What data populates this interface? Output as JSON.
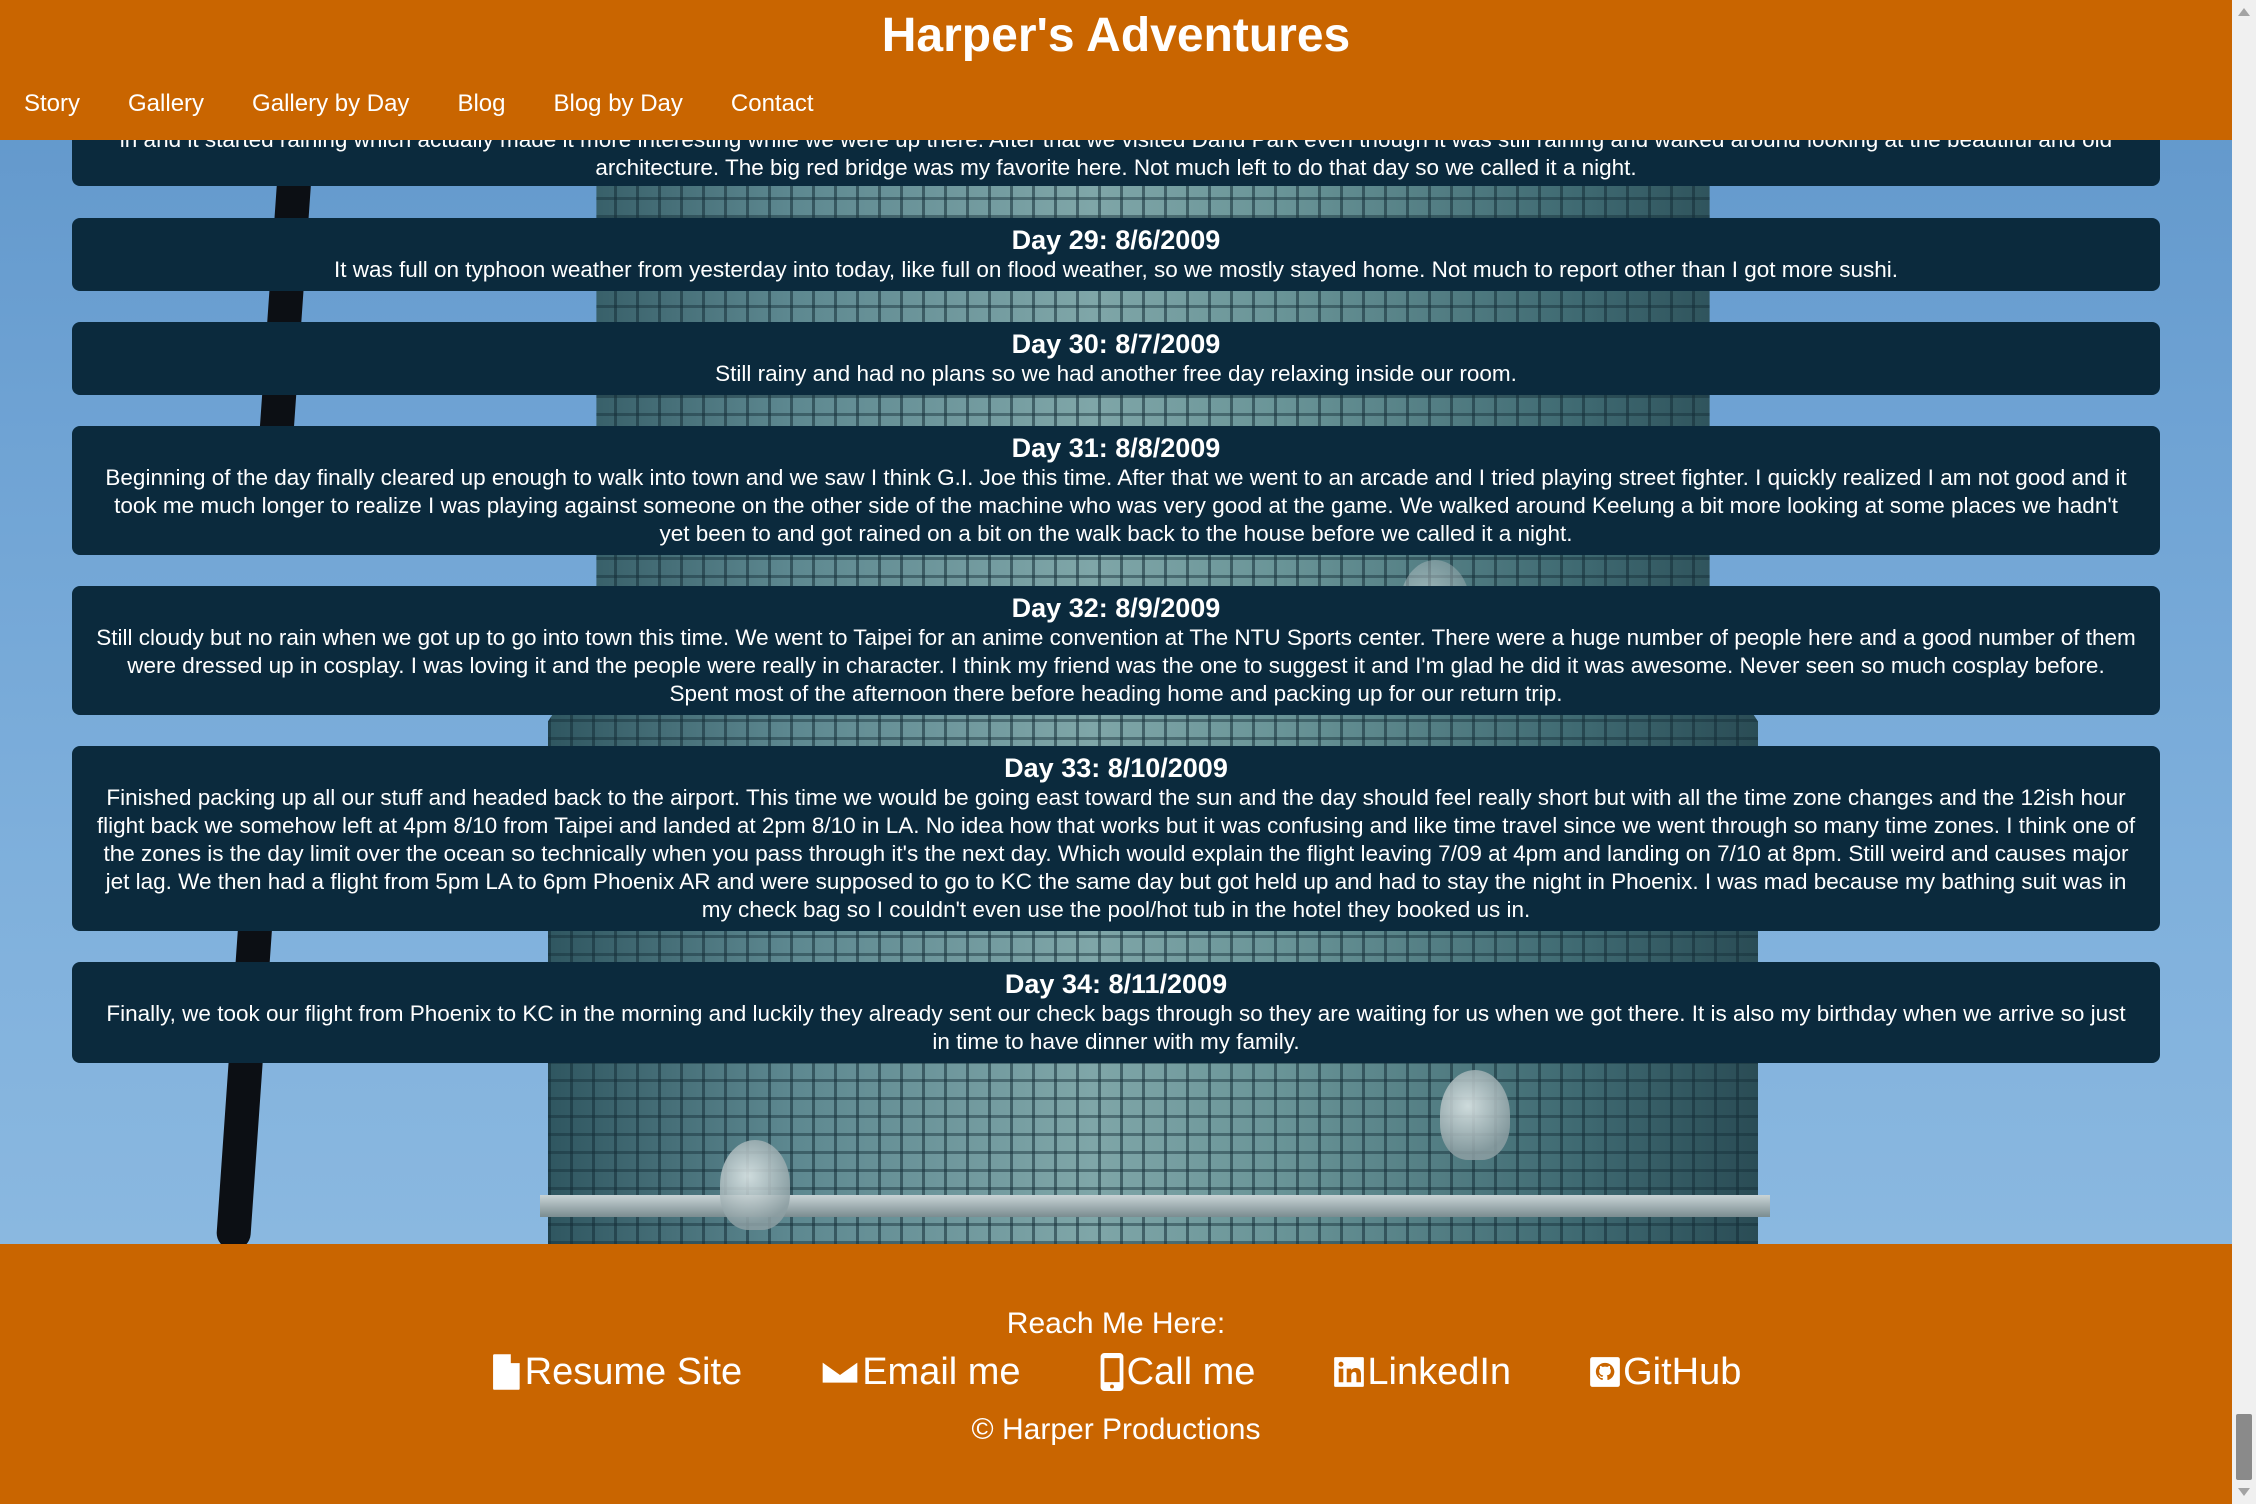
{
  "header": {
    "title": "Harper's Adventures",
    "nav": [
      "Story",
      "Gallery",
      "Gallery by Day",
      "Blog",
      "Blog by Day",
      "Contact"
    ]
  },
  "days": [
    {
      "title": "",
      "text": "in and it started raining which actually made it more interesting while we were up there. After that we visited Dand Park even though it was still raining and walked around looking at the beautiful and old architecture. The big red bridge was my favorite here. Not much left to do that day so we called it a night."
    },
    {
      "title": "Day 29: 8/6/2009",
      "text": "It was full on typhoon weather from yesterday into today, like full on flood weather, so we mostly stayed home. Not much to report other than I got more sushi."
    },
    {
      "title": "Day 30: 8/7/2009",
      "text": "Still rainy and had no plans so we had another free day relaxing inside our room."
    },
    {
      "title": "Day 31: 8/8/2009",
      "text": "Beginning of the day finally cleared up enough to walk into town and we saw I think G.I. Joe this time. After that we went to an arcade and I tried playing street fighter. I quickly realized I am not good and it took me much longer to realize I was playing against someone on the other side of the machine who was very good at the game. We walked around Keelung a bit more looking at some places we hadn't yet been to and got rained on a bit on the walk back to the house before we called it a night."
    },
    {
      "title": "Day 32: 8/9/2009",
      "text": "Still cloudy but no rain when we got up to go into town this time. We went to Taipei for an anime convention at The NTU Sports center. There were a huge number of people here and a good number of them were dressed up in cosplay. I was loving it and the people were really in character. I think my friend was the one to suggest it and I'm glad he did it was awesome. Never seen so much cosplay before. Spent most of the afternoon there before heading home and packing up for our return trip."
    },
    {
      "title": "Day 33: 8/10/2009",
      "text": "Finished packing up all our stuff and headed back to the airport. This time we would be going east toward the sun and the day should feel really short but with all the time zone changes and the 12ish hour flight back we somehow left at 4pm 8/10 from Taipei and landed at 2pm 8/10 in LA. No idea how that works but it was confusing and like time travel since we went through so many time zones. I think one of the zones is the day limit over the ocean so technically when you pass through it's the next day. Which would explain the flight leaving 7/09 at 4pm and landing on 7/10 at 8pm. Still weird and causes major jet lag. We then had a flight from 5pm LA to 6pm Phoenix AR and were supposed to go to KC the same day but got held up and had to stay the night in Phoenix. I was mad because my bathing suit was in my check bag so I couldn't even use the pool/hot tub in the hotel they booked us in."
    },
    {
      "title": "Day 34: 8/11/2009",
      "text": "Finally, we took our flight from Phoenix to KC in the morning and luckily they already sent our check bags through so they are waiting for us when we got there. It is also my birthday when we arrive so just in time to have dinner with my family."
    }
  ],
  "footer": {
    "reach": "Reach Me Here:",
    "links": [
      {
        "label": "Resume Site",
        "icon": "file-icon"
      },
      {
        "label": "Email me",
        "icon": "envelope-icon"
      },
      {
        "label": "Call me",
        "icon": "mobile-phone-icon"
      },
      {
        "label": "LinkedIn",
        "icon": "linkedin-icon"
      },
      {
        "label": "GitHub",
        "icon": "github-icon"
      }
    ],
    "copyright": "© Harper Productions"
  },
  "colors": {
    "header_bg": "#c96500",
    "card_bg": "#0b2a3d",
    "text": "#ffffff"
  }
}
